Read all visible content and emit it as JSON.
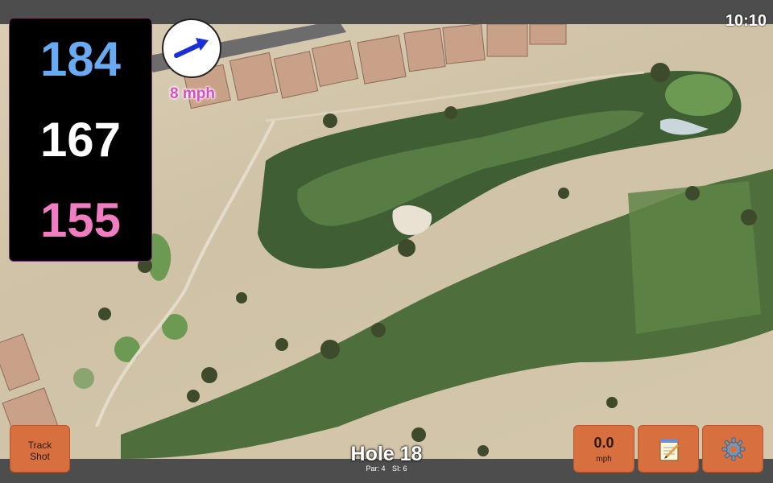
{
  "status": {
    "time": "10:10"
  },
  "distances": {
    "back": "184",
    "middle": "167",
    "front": "155"
  },
  "wind": {
    "speed": "8 mph",
    "icon": "wind-arrow-icon",
    "direction": "east-northeast"
  },
  "hole": {
    "title": "Hole 18",
    "par": "Par: 4",
    "stroke_index": "SI: 6"
  },
  "buttons": {
    "track_shot": "Track\nShot",
    "speed_value": "0.0",
    "speed_unit": "mph",
    "notes_icon": "notepad-icon",
    "settings_icon": "gear-icon"
  },
  "colors": {
    "back_distance": "#6aaaf3",
    "middle_distance": "#ffffff",
    "front_distance": "#f07cc1",
    "button": "#d7703e",
    "wind_text": "#d34fc4"
  }
}
